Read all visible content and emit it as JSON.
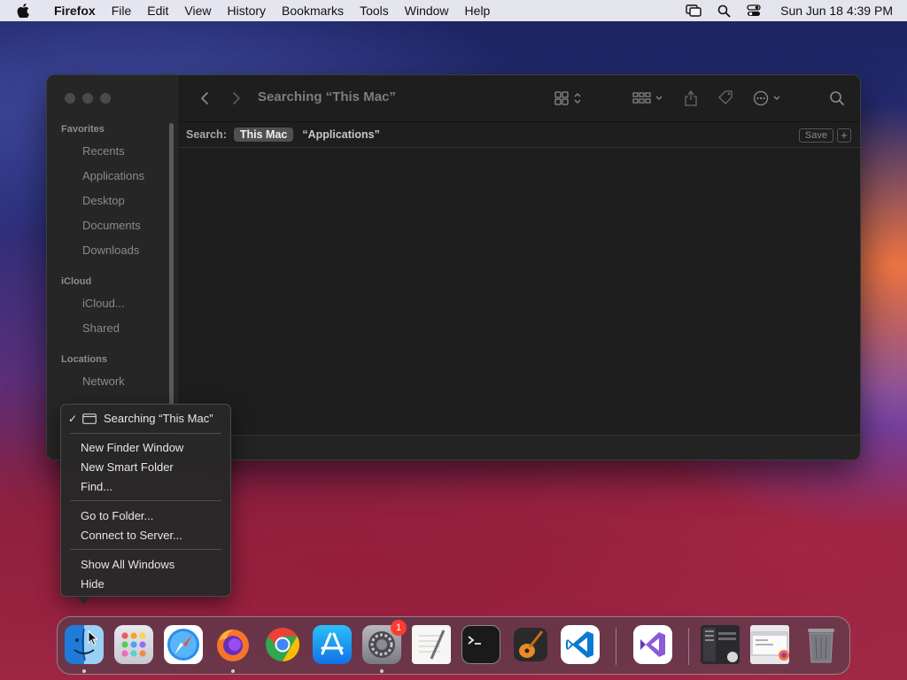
{
  "menubar": {
    "app_name": "Firefox",
    "items": [
      "File",
      "Edit",
      "View",
      "History",
      "Bookmarks",
      "Tools",
      "Window",
      "Help"
    ],
    "clock": "Sun Jun 18  4:39 PM"
  },
  "finder": {
    "title": "Searching “This Mac”",
    "sidebar": {
      "favorites_heading": "Favorites",
      "favorites": [
        "Recents",
        "Applications",
        "Desktop",
        "Documents",
        "Downloads"
      ],
      "icloud_heading": "iCloud",
      "icloud": [
        "iCloud...",
        "Shared"
      ],
      "locations_heading": "Locations",
      "locations": [
        "Network"
      ]
    },
    "search": {
      "label": "Search:",
      "active_scope": "This Mac",
      "other_scope": "“Applications”",
      "save_label": "Save",
      "add_label": "+"
    }
  },
  "context_menu": {
    "checked_window": "Searching “This Mac”",
    "items": [
      "New Finder Window",
      "New Smart Folder",
      "Find...",
      "Go to Folder...",
      "Connect to Server...",
      "Show All Windows",
      "Hide"
    ]
  },
  "dock": {
    "system_prefs_badge": "1"
  },
  "colors": {
    "window_bg": "#1e1e1e",
    "sidebar_bg": "#262626",
    "menu_bg": "#282828",
    "badge": "#ff3b30"
  }
}
